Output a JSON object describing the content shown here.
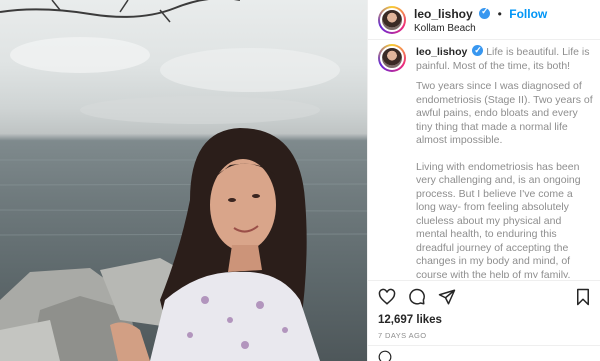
{
  "post": {
    "username": "leo_lishoy",
    "follow_label": "Follow",
    "separator": "•",
    "location": "Kollam Beach",
    "caption_intro": "Life is beautiful. Life is painful. Most of the time, its both!",
    "caption_paragraphs": [
      "Two years since I was diagnosed of endometriosis (Stage II). Two years of awful pains, endo bloats and every tiny thing that made a normal life almost impossible.",
      "Living with endometriosis has been very challenging and, is an ongoing process. But I believe I've come a long way- from feeling absolutely clueless about my physical and mental health, to enduring this dreadful journey of accepting the changes in my body and mind, of course with the help of my family, closest friends and my fav Dr Lakshmi ❤️❤️."
    ],
    "likes": "12,697 likes",
    "timestamp": "7 DAYS AGO"
  },
  "icons": {
    "like": "heart-icon",
    "comment": "comment-icon",
    "share": "share-icon",
    "save": "bookmark-icon",
    "verified": "verified-badge-icon"
  },
  "colors": {
    "follow": "#0095f6",
    "verified": "#3897f0",
    "text_primary": "#262626",
    "text_secondary": "#8e8e8e"
  }
}
